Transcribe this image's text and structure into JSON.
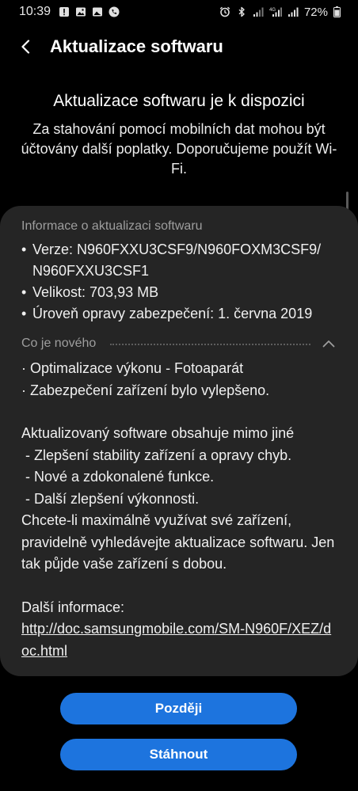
{
  "status_bar": {
    "time": "10:39",
    "battery": "72%",
    "left_icons": [
      "warning-icon",
      "image-icon",
      "gallery-icon",
      "phone-icon"
    ],
    "right_icons": [
      "alarm-icon",
      "bluetooth-icon",
      "signal-icon",
      "4g-signal-icon",
      "signal-icon-2"
    ],
    "network_label": "4G"
  },
  "header": {
    "title": "Aktualizace softwaru"
  },
  "intro": {
    "heading": "Aktualizace softwaru je k dispozici",
    "subtext": "Za stahování pomocí mobilních dat mohou být účtovány další poplatky. Doporučujeme použít Wi-Fi."
  },
  "info": {
    "title": "Informace o aktualizaci softwaru",
    "items": [
      "Verze: N960FXXU3CSF9/N960FOXM3CSF9/ N960FXXU3CSF1",
      "Velikost: 703,93 MB",
      "Úroveň opravy zabezpečení: 1. června 2019"
    ]
  },
  "whats_new": {
    "title": "Co je nového",
    "lines": [
      "· Optimalizace výkonu - Fotoaparát",
      "· Zabezpečení zařízení bylo vylepšeno."
    ],
    "details": [
      "Aktualizovaný software obsahuje mimo jiné",
      " - Zlepšení stability zařízení a opravy chyb.",
      " - Nové a zdokonalené funkce.",
      " - Další zlepšení výkonnosti.",
      "Chcete-li maximálně využívat své zařízení, pravidelně vyhledávejte aktualizace softwaru. Jen tak půjde vaše zařízení s dobou."
    ],
    "more_info_label": "Další informace:",
    "more_info_link": "http://doc.samsungmobile.com/SM-N960F/XEZ/doc.html"
  },
  "buttons": {
    "later": "Později",
    "download": "Stáhnout"
  },
  "colors": {
    "background": "#000000",
    "card": "#252525",
    "button": "#1d74de",
    "secondary_text": "#9e9e9e"
  }
}
